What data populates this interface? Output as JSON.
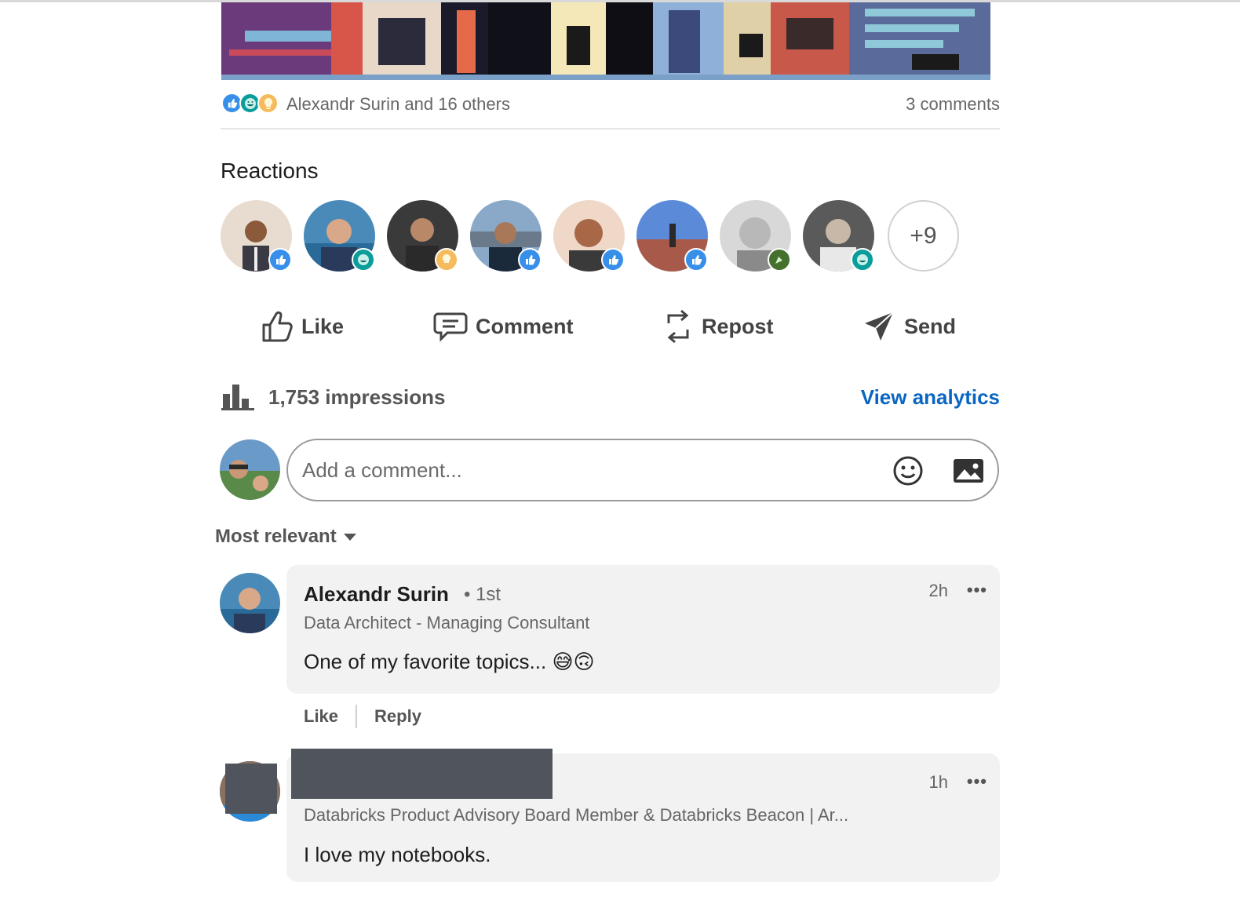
{
  "social_counts": {
    "reactors": "Alexandr Surin and 16 others",
    "comments": "3 comments",
    "reaction_icons": [
      "like-icon",
      "support-icon",
      "insightful-icon"
    ]
  },
  "reactions": {
    "title": "Reactions",
    "more_count": "+9",
    "avatars": [
      {
        "badge": "like-icon",
        "color": "#378fe9"
      },
      {
        "badge": "support-icon",
        "color": "#0a9d9a"
      },
      {
        "badge": "insightful-icon",
        "color": "#f5bb5c"
      },
      {
        "badge": "like-icon",
        "color": "#378fe9"
      },
      {
        "badge": "like-icon",
        "color": "#378fe9"
      },
      {
        "badge": "like-icon",
        "color": "#378fe9"
      },
      {
        "badge": "celebrate-icon",
        "color": "#44712e"
      },
      {
        "badge": "support-icon",
        "color": "#0a9d9a"
      }
    ]
  },
  "actions": {
    "like": "Like",
    "comment": "Comment",
    "repost": "Repost",
    "send": "Send"
  },
  "impressions": {
    "text": "1,753 impressions",
    "analytics_link": "View analytics"
  },
  "comment_box": {
    "placeholder": "Add a comment..."
  },
  "sort": {
    "label": "Most relevant"
  },
  "comments": [
    {
      "name": "Alexandr Surin",
      "degree": "• 1st",
      "headline": "Data Architect - Managing Consultant",
      "text": "One of my favorite topics... 😅🙃",
      "time": "2h",
      "more": "•••",
      "like": "Like",
      "reply": "Reply"
    },
    {
      "name": "",
      "headline": "Databricks Product Advisory Board Member & Databricks Beacon | Ar...",
      "text": "I love my notebooks.",
      "time": "1h",
      "more": "•••"
    }
  ],
  "colors": {
    "accent": "#0a66c2",
    "like": "#378fe9",
    "support": "#0a9d9a",
    "insightful": "#f5bb5c",
    "celebrate": "#44712e",
    "bubble": "#f2f2f2"
  }
}
